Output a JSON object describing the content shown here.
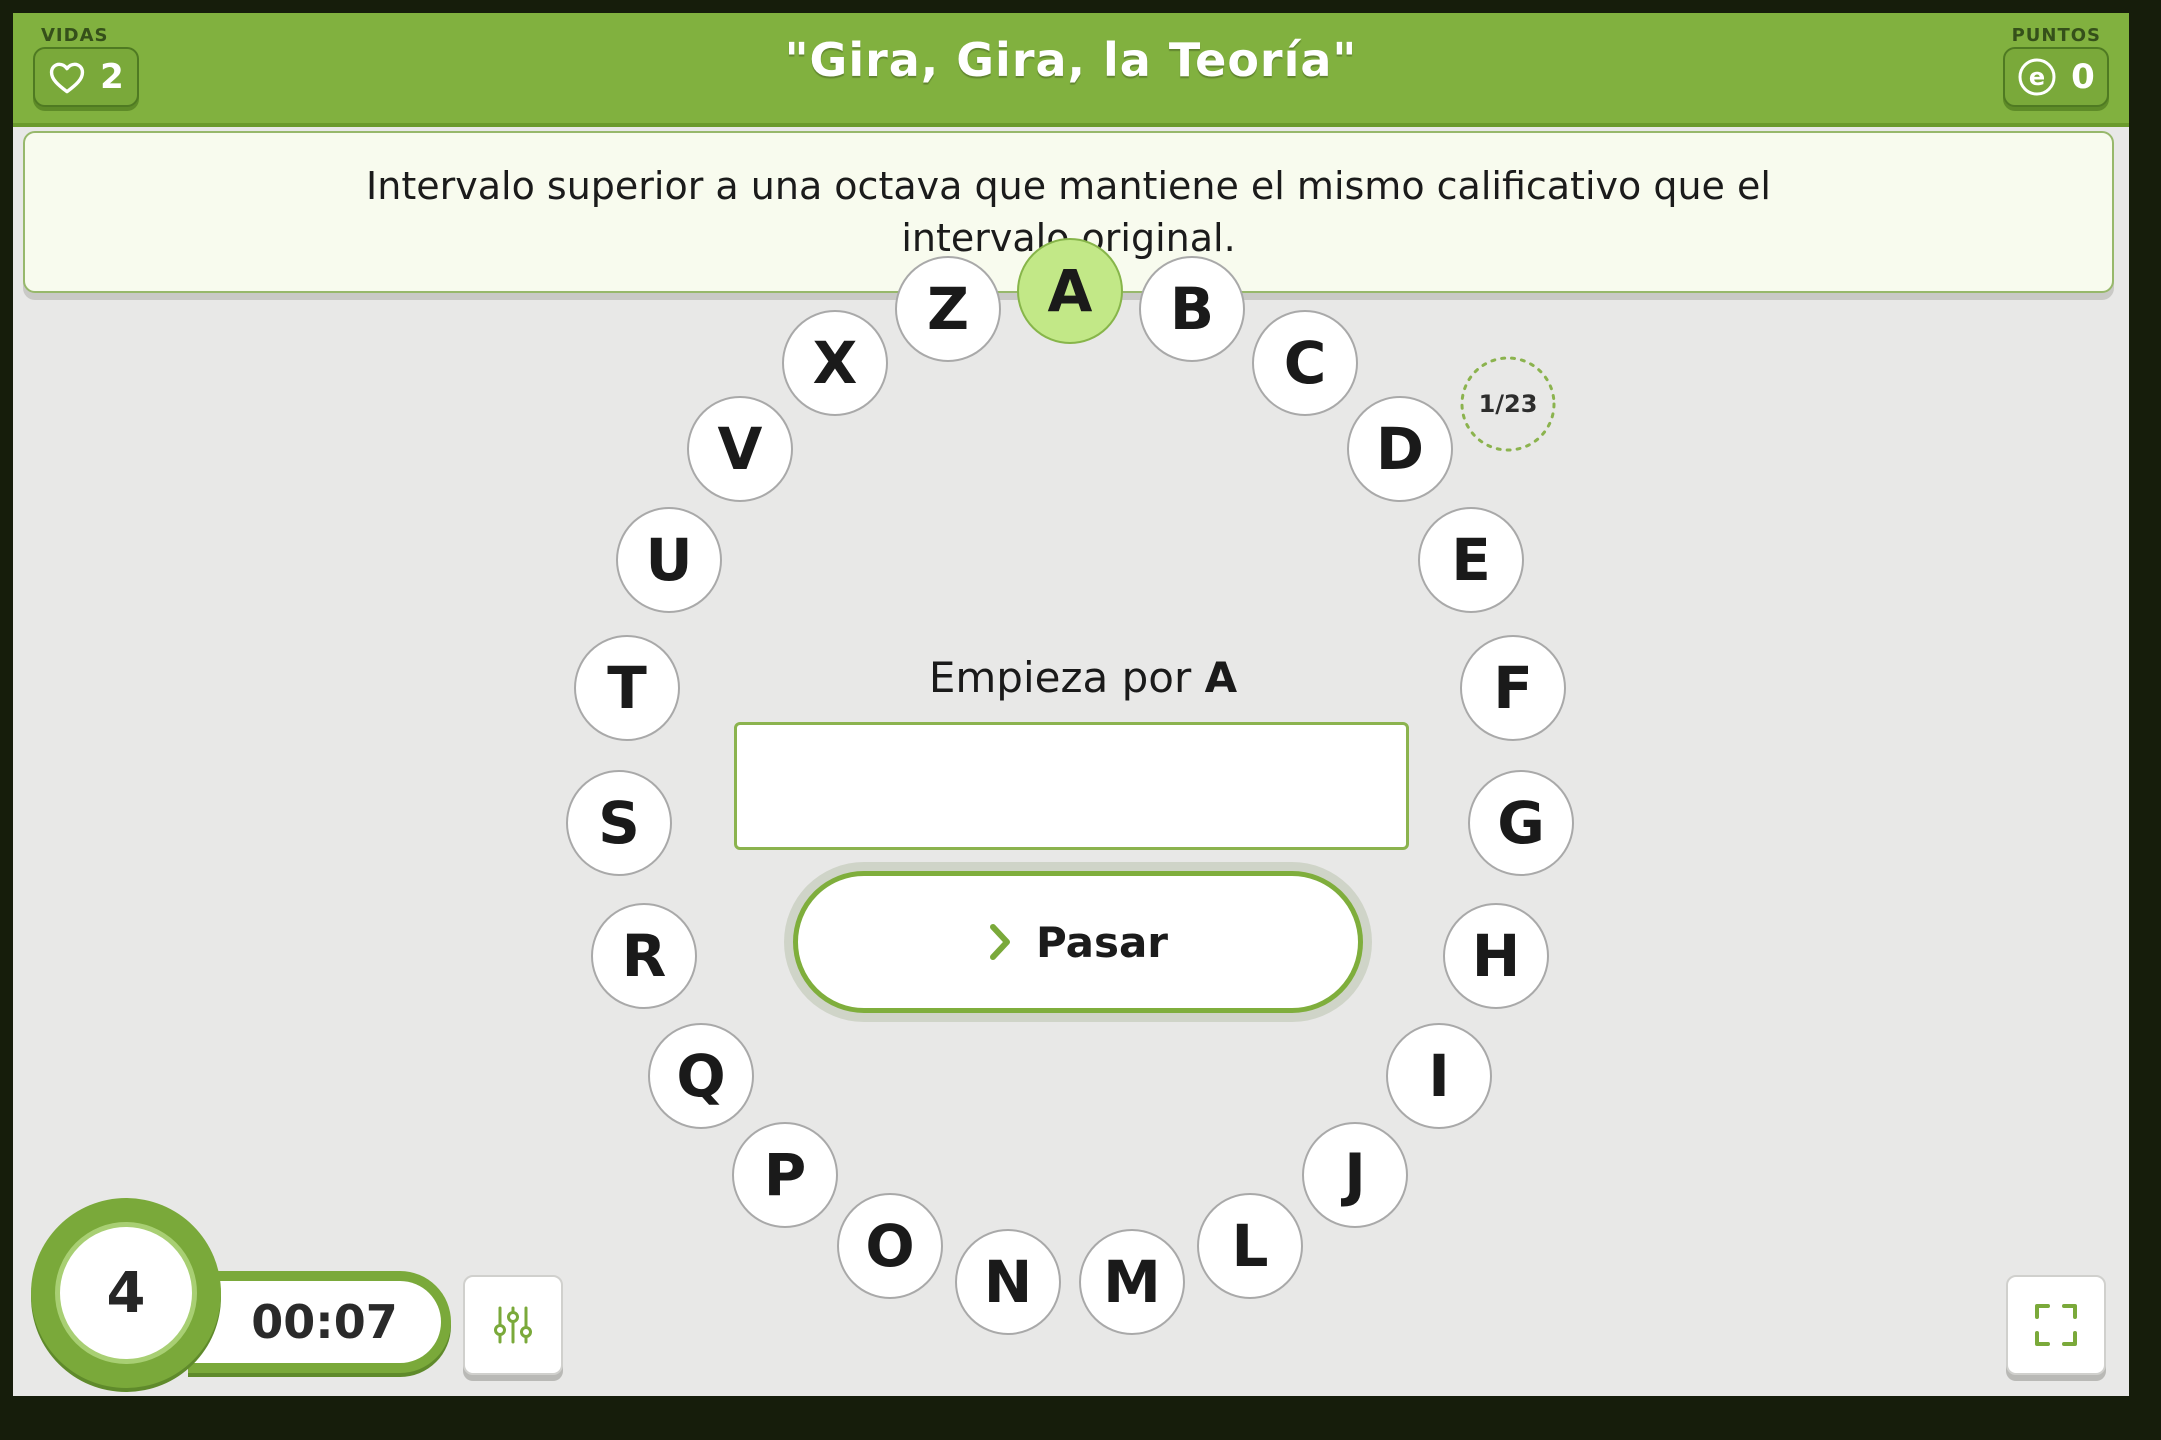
{
  "header": {
    "lives_label": "VIDAS",
    "lives_value": "2",
    "title": "\"Gira, Gira, la Teoría\"",
    "points_label": "PUNTOS",
    "points_value": "0",
    "points_icon_glyph": "e"
  },
  "question": {
    "text": "Intervalo superior a una octava que mantiene el mismo calificativo que el intervalo original."
  },
  "progress": {
    "text": "1/23"
  },
  "prompt": {
    "prefix": "Empieza por",
    "letter": "A"
  },
  "answer": {
    "value": "",
    "placeholder": ""
  },
  "pass_button": {
    "label": "Pasar"
  },
  "letters": [
    "A",
    "B",
    "C",
    "D",
    "E",
    "F",
    "G",
    "H",
    "I",
    "J",
    "L",
    "M",
    "N",
    "O",
    "P",
    "Q",
    "R",
    "S",
    "T",
    "U",
    "V",
    "X",
    "Z"
  ],
  "active_letter": "A",
  "timer": {
    "count": "4",
    "time": "00:07"
  },
  "icons": {
    "lives": "heart-icon",
    "points": "coin-icon",
    "pass": "chevron-right-icon",
    "settings": "sliders-icon",
    "fullscreen": "fullscreen-icon"
  },
  "colors": {
    "accent": "#81b13f",
    "active_letter": "#c2e887",
    "background": "#e8e8e7"
  }
}
